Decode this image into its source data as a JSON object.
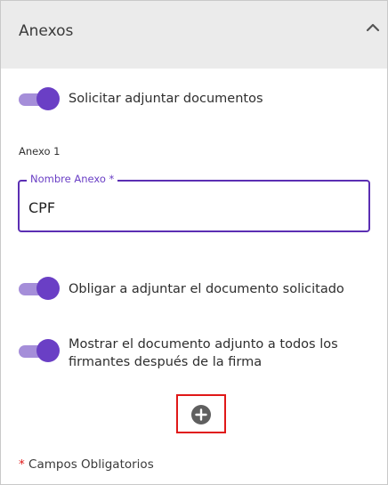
{
  "section": {
    "title": "Anexos"
  },
  "toggles": [
    {
      "label": "Solicitar adjuntar documentos",
      "state": "on"
    },
    {
      "label": "Obligar a adjuntar el documento solicitado",
      "state": "on"
    },
    {
      "label": "Mostrar el documento adjunto a todos los firmantes después de la firma",
      "state": "on"
    }
  ],
  "annex": {
    "heading": "Anexo 1",
    "field_label": "Nombre Anexo *",
    "field_value": "CPF"
  },
  "footer": {
    "star": "*",
    "note": " Campos Obligatorios"
  },
  "colors": {
    "accent": "#6a3fc5",
    "accent_light": "#a58ed9",
    "highlight_box": "#e01818",
    "header_bg": "#ebebeb"
  },
  "icons": {
    "collapse": "chevron-up-icon",
    "add": "plus-circle-icon"
  }
}
